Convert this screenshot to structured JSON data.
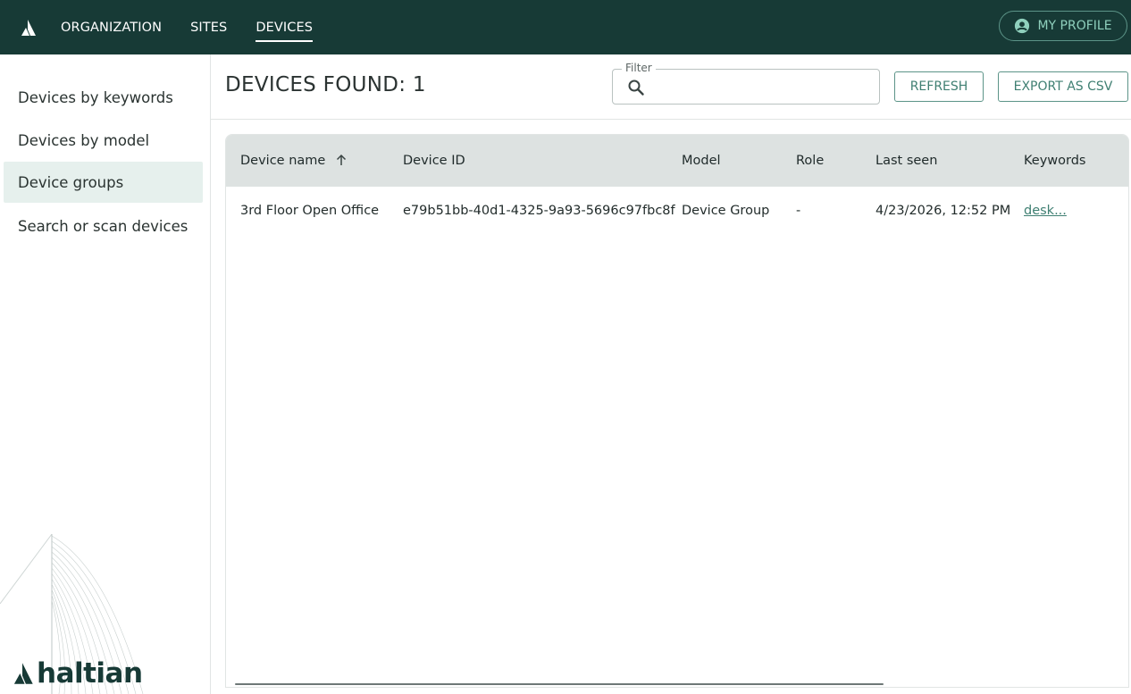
{
  "nav": {
    "items": [
      {
        "label": "ORGANIZATION",
        "active": false
      },
      {
        "label": "SITES",
        "active": false
      },
      {
        "label": "DEVICES",
        "active": true
      }
    ],
    "profile_label": "MY PROFILE"
  },
  "sidebar": {
    "items": [
      {
        "label": "Devices by keywords",
        "selected": false
      },
      {
        "label": "Devices by model",
        "selected": false
      },
      {
        "label": "Device groups",
        "selected": true
      },
      {
        "label": "Search or scan devices",
        "selected": false
      }
    ],
    "brand_name": "haltian"
  },
  "main": {
    "title": "DEVICES FOUND: 1",
    "filter": {
      "label": "Filter",
      "value": "",
      "placeholder": ""
    },
    "refresh_label": "REFRESH",
    "export_label": "EXPORT AS CSV"
  },
  "table": {
    "columns": [
      "Device name",
      "Device ID",
      "Model",
      "Role",
      "Last seen",
      "Keywords"
    ],
    "sort": {
      "column": "Device name",
      "direction": "ascending"
    },
    "rows": [
      {
        "device_name": "3rd Floor Open Office",
        "device_id": "e79b51bb-40d1-4325-9a93-5696c97fbc8f",
        "model": "Device Group",
        "role": "-",
        "last_seen": "4/23/2026, 12:52 PM",
        "keywords": "desk..."
      }
    ]
  },
  "colors": {
    "topbar": "#173a36",
    "accent": "#3f7f72",
    "selected_bg": "#e6f0ed",
    "table_header_bg": "#dde2e1"
  },
  "icons": [
    "haltian-logo-icon",
    "account-circle-icon",
    "search-icon",
    "arrow-up-icon"
  ]
}
